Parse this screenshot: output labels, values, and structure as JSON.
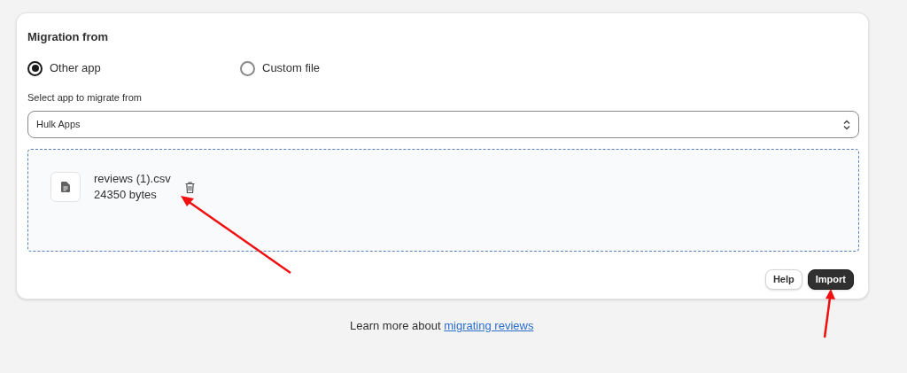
{
  "card": {
    "title": "Migration from",
    "sources": [
      {
        "label": "Other app",
        "selected": true
      },
      {
        "label": "Custom file",
        "selected": false
      }
    ],
    "select": {
      "label": "Select app to migrate from",
      "value": "Hulk Apps"
    },
    "file": {
      "name": "reviews (1).csv",
      "size": "24350 bytes"
    },
    "buttons": [
      {
        "label": "Help",
        "kind": "secondary"
      },
      {
        "label": "Import",
        "kind": "primary"
      }
    ]
  },
  "footer": {
    "text": "Learn more about",
    "link": "migrating reviews"
  }
}
